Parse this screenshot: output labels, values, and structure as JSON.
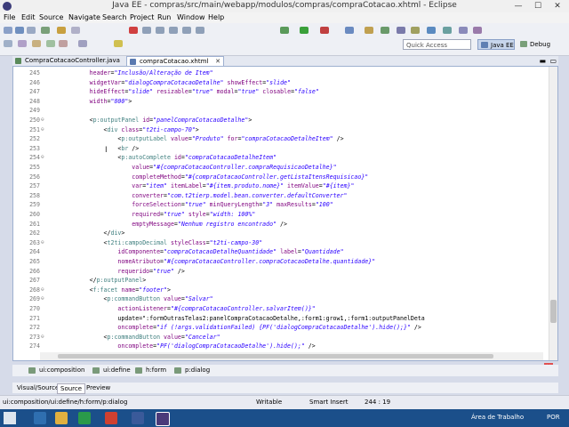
{
  "window": {
    "title": "Java EE - compras/src/main/webapp/modulos/compras/compraCotacao.xhtml - Eclipse"
  },
  "menu": [
    "File",
    "Edit",
    "Source",
    "Navigate",
    "Search",
    "Project",
    "Run",
    "Window",
    "Help"
  ],
  "toolbar": {
    "quick_access": "Quick Access",
    "perspectives": [
      "Java EE",
      "Debug"
    ]
  },
  "tabs": [
    {
      "label": "CompraCotacaoController.java",
      "active": false
    },
    {
      "label": "compraCotacao.xhtml",
      "active": true,
      "close": "✕"
    }
  ],
  "editor": {
    "lines": [
      {
        "num": "245",
        "fold": "",
        "code": "            header=\"Inclusão/Alteração de Item\""
      },
      {
        "num": "246",
        "fold": "",
        "code": "            widgetVar=\"dialogCompraCotacaoDetalhe\" showEffect=\"slide\""
      },
      {
        "num": "247",
        "fold": "",
        "code": "            hideEffect=\"slide\" resizable=\"true\" modal=\"true\" closable=\"false\""
      },
      {
        "num": "248",
        "fold": "",
        "code": "            width=\"800\">"
      },
      {
        "num": "249",
        "fold": "",
        "code": ""
      },
      {
        "num": "250",
        "fold": "⊖",
        "code": "            <p:outputPanel id=\"panelCompraCotacaoDetalhe\">"
      },
      {
        "num": "251",
        "fold": "⊖",
        "code": "                <div class=\"t2ti-campo-70\">"
      },
      {
        "num": "252",
        "fold": "",
        "code": "                    <p:outputLabel value=\"Produto\" for=\"compraCotacaoDetalheItem\" />"
      },
      {
        "num": "253",
        "fold": "",
        "code": "                    <br />"
      },
      {
        "num": "254",
        "fold": "⊖",
        "code": "                    <p:autoComplete id=\"compraCotacaoDetalheItem\""
      },
      {
        "num": "255",
        "fold": "",
        "code": "                        value=\"#{compraCotacaoController.compraRequisicaoDetalhe}\""
      },
      {
        "num": "256",
        "fold": "",
        "code": "                        completeMethod=\"#{compraCotacaoController.getListaItensRequisicao}\""
      },
      {
        "num": "257",
        "fold": "",
        "code": "                        var=\"item\" itemLabel=\"#{item.produto.nome}\" itemValue=\"#{item}\""
      },
      {
        "num": "258",
        "fold": "",
        "code": "                        converter=\"com.t2tierp.model.bean.converter.defaultConverter\""
      },
      {
        "num": "259",
        "fold": "",
        "code": "                        forceSelection=\"true\" minQueryLength=\"3\" maxResults=\"100\""
      },
      {
        "num": "260",
        "fold": "",
        "code": "                        required=\"true\" style=\"width: 100%\""
      },
      {
        "num": "261",
        "fold": "",
        "code": "                        emptyMessage=\"Nenhum registro encontrado\" />"
      },
      {
        "num": "262",
        "fold": "",
        "code": "                </div>"
      },
      {
        "num": "263",
        "fold": "⊖",
        "code": "                <t2ti:campoDecimal styleClass=\"t2ti-campo-30\""
      },
      {
        "num": "264",
        "fold": "",
        "code": "                    idComponente=\"compraCotacaoDetalheQuantidade\" label=\"Quantidade\""
      },
      {
        "num": "265",
        "fold": "",
        "code": "                    nomeAtributo=\"#{compraCotacaoController.compraCotacaoDetalhe.quantidade}\""
      },
      {
        "num": "266",
        "fold": "",
        "code": "                    requerido=\"true\" />"
      },
      {
        "num": "267",
        "fold": "",
        "code": "            </p:outputPanel>"
      },
      {
        "num": "268",
        "fold": "⊖",
        "code": "            <f:facet name=\"footer\">"
      },
      {
        "num": "269",
        "fold": "⊖",
        "code": "                <p:commandButton value=\"Salvar\""
      },
      {
        "num": "270",
        "fold": "",
        "code": "                    actionListener=\"#{compraCotacaoController.salvarItem()}\""
      },
      {
        "num": "271",
        "fold": "",
        "code": "                    update=\":formOutrasTelas2:panelCompraCotacaoDetalhe,:form1:grow1,:form1:outputPanelDeta"
      },
      {
        "num": "272",
        "fold": "",
        "code": "                    oncomplete=\"if (!args.validationFailed) {PF('dialogCompraCotacaoDetalhe').hide();}\" />"
      },
      {
        "num": "273",
        "fold": "⊖",
        "code": "                <p:commandButton value=\"Cancelar\""
      },
      {
        "num": "274",
        "fold": "",
        "code": "                    oncomplete=\"PF('dialogCompraCotacaoDetalhe').hide();\" />"
      }
    ]
  },
  "breadcrumbs": [
    "ui:composition",
    "ui:define",
    "h:form",
    "p:dialog"
  ],
  "source_tabs": [
    "Visual/Source",
    "Source",
    "Preview"
  ],
  "status": {
    "path": "ui:composition/ui:define/h:form/p:dialog",
    "writable": "Writable",
    "insert_mode": "Smart Insert",
    "position": "244 : 19"
  },
  "taskbar": {
    "tray_label": "Área de Trabalho",
    "lang": "POR"
  },
  "colors": {
    "accent": "#3f7f7f",
    "attr": "#7f007f",
    "string": "#2a00ff",
    "taskbar": "#1b4f8a"
  }
}
